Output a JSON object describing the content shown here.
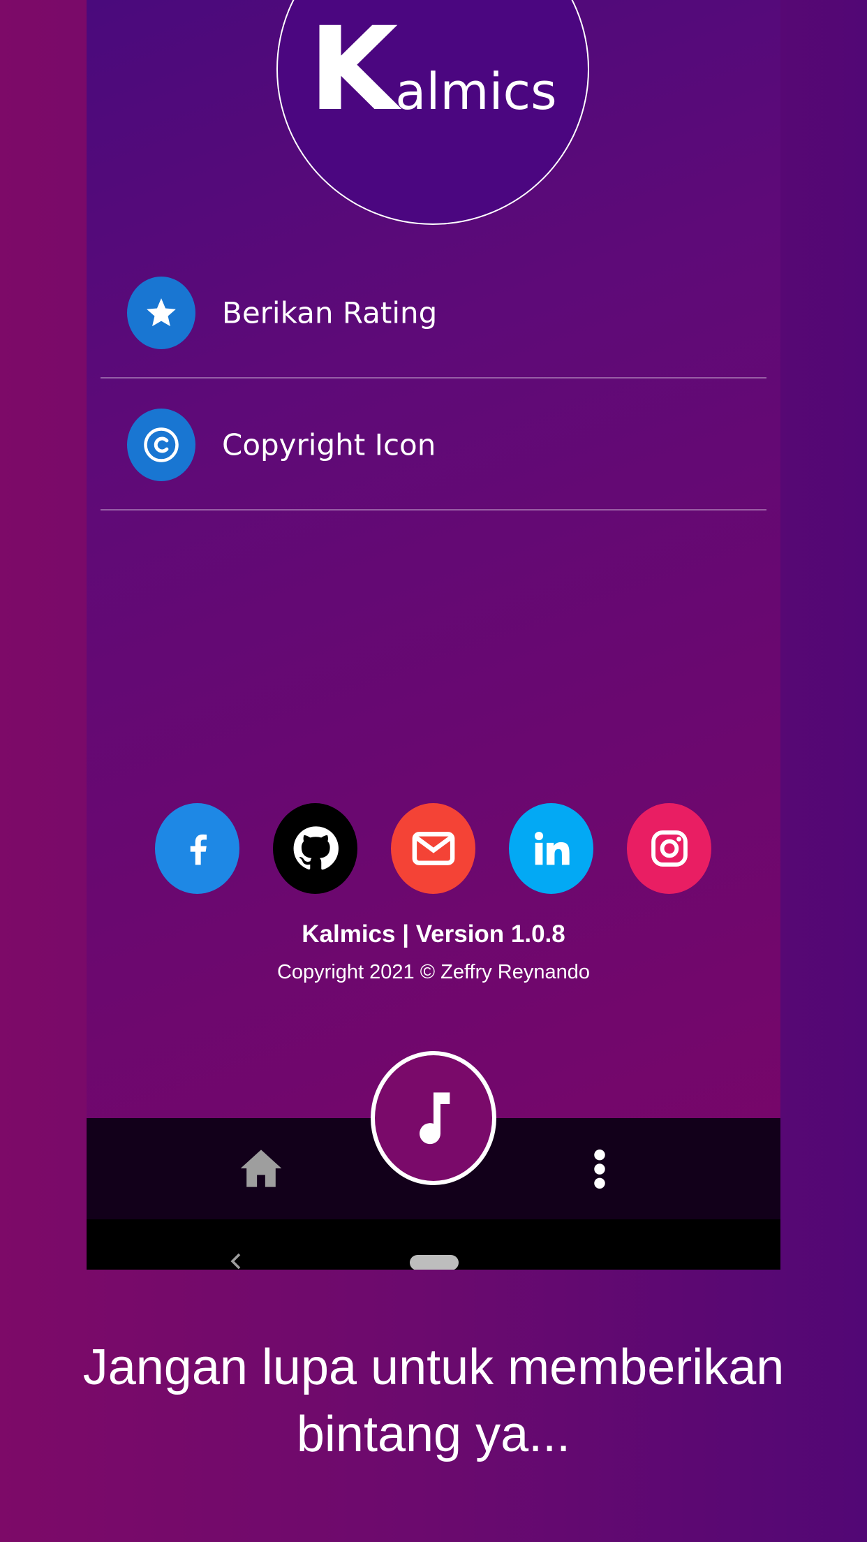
{
  "logo": {
    "big_letter": "K",
    "rest": "almics"
  },
  "menu": [
    {
      "label": "Berikan Rating",
      "icon": "star-icon"
    },
    {
      "label": "Copyright Icon",
      "icon": "copyright-icon"
    }
  ],
  "socials": [
    {
      "name": "facebook",
      "icon": "facebook-icon",
      "color": "#1e88e5"
    },
    {
      "name": "github",
      "icon": "github-icon",
      "color": "#000000"
    },
    {
      "name": "email",
      "icon": "envelope-icon",
      "color": "#f44336"
    },
    {
      "name": "linkedin",
      "icon": "linkedin-icon",
      "color": "#03a9f4"
    },
    {
      "name": "instagram",
      "icon": "instagram-icon",
      "color": "#e91e63"
    }
  ],
  "footer": {
    "version": "Kalmics | Version 1.0.8",
    "copyright": "Copyright 2021 © Zeffry Reynando"
  },
  "nav": {
    "home_icon": "home-icon",
    "center_icon": "music-note-icon",
    "more_icon": "more-vertical-icon"
  },
  "colors": {
    "accent": "#1976d2",
    "nav_bg": "#12001a",
    "fab_bg": "#7a0a6a"
  },
  "caption": {
    "line1": "Jangan lupa untuk memberikan",
    "line2": "bintang ya..."
  }
}
